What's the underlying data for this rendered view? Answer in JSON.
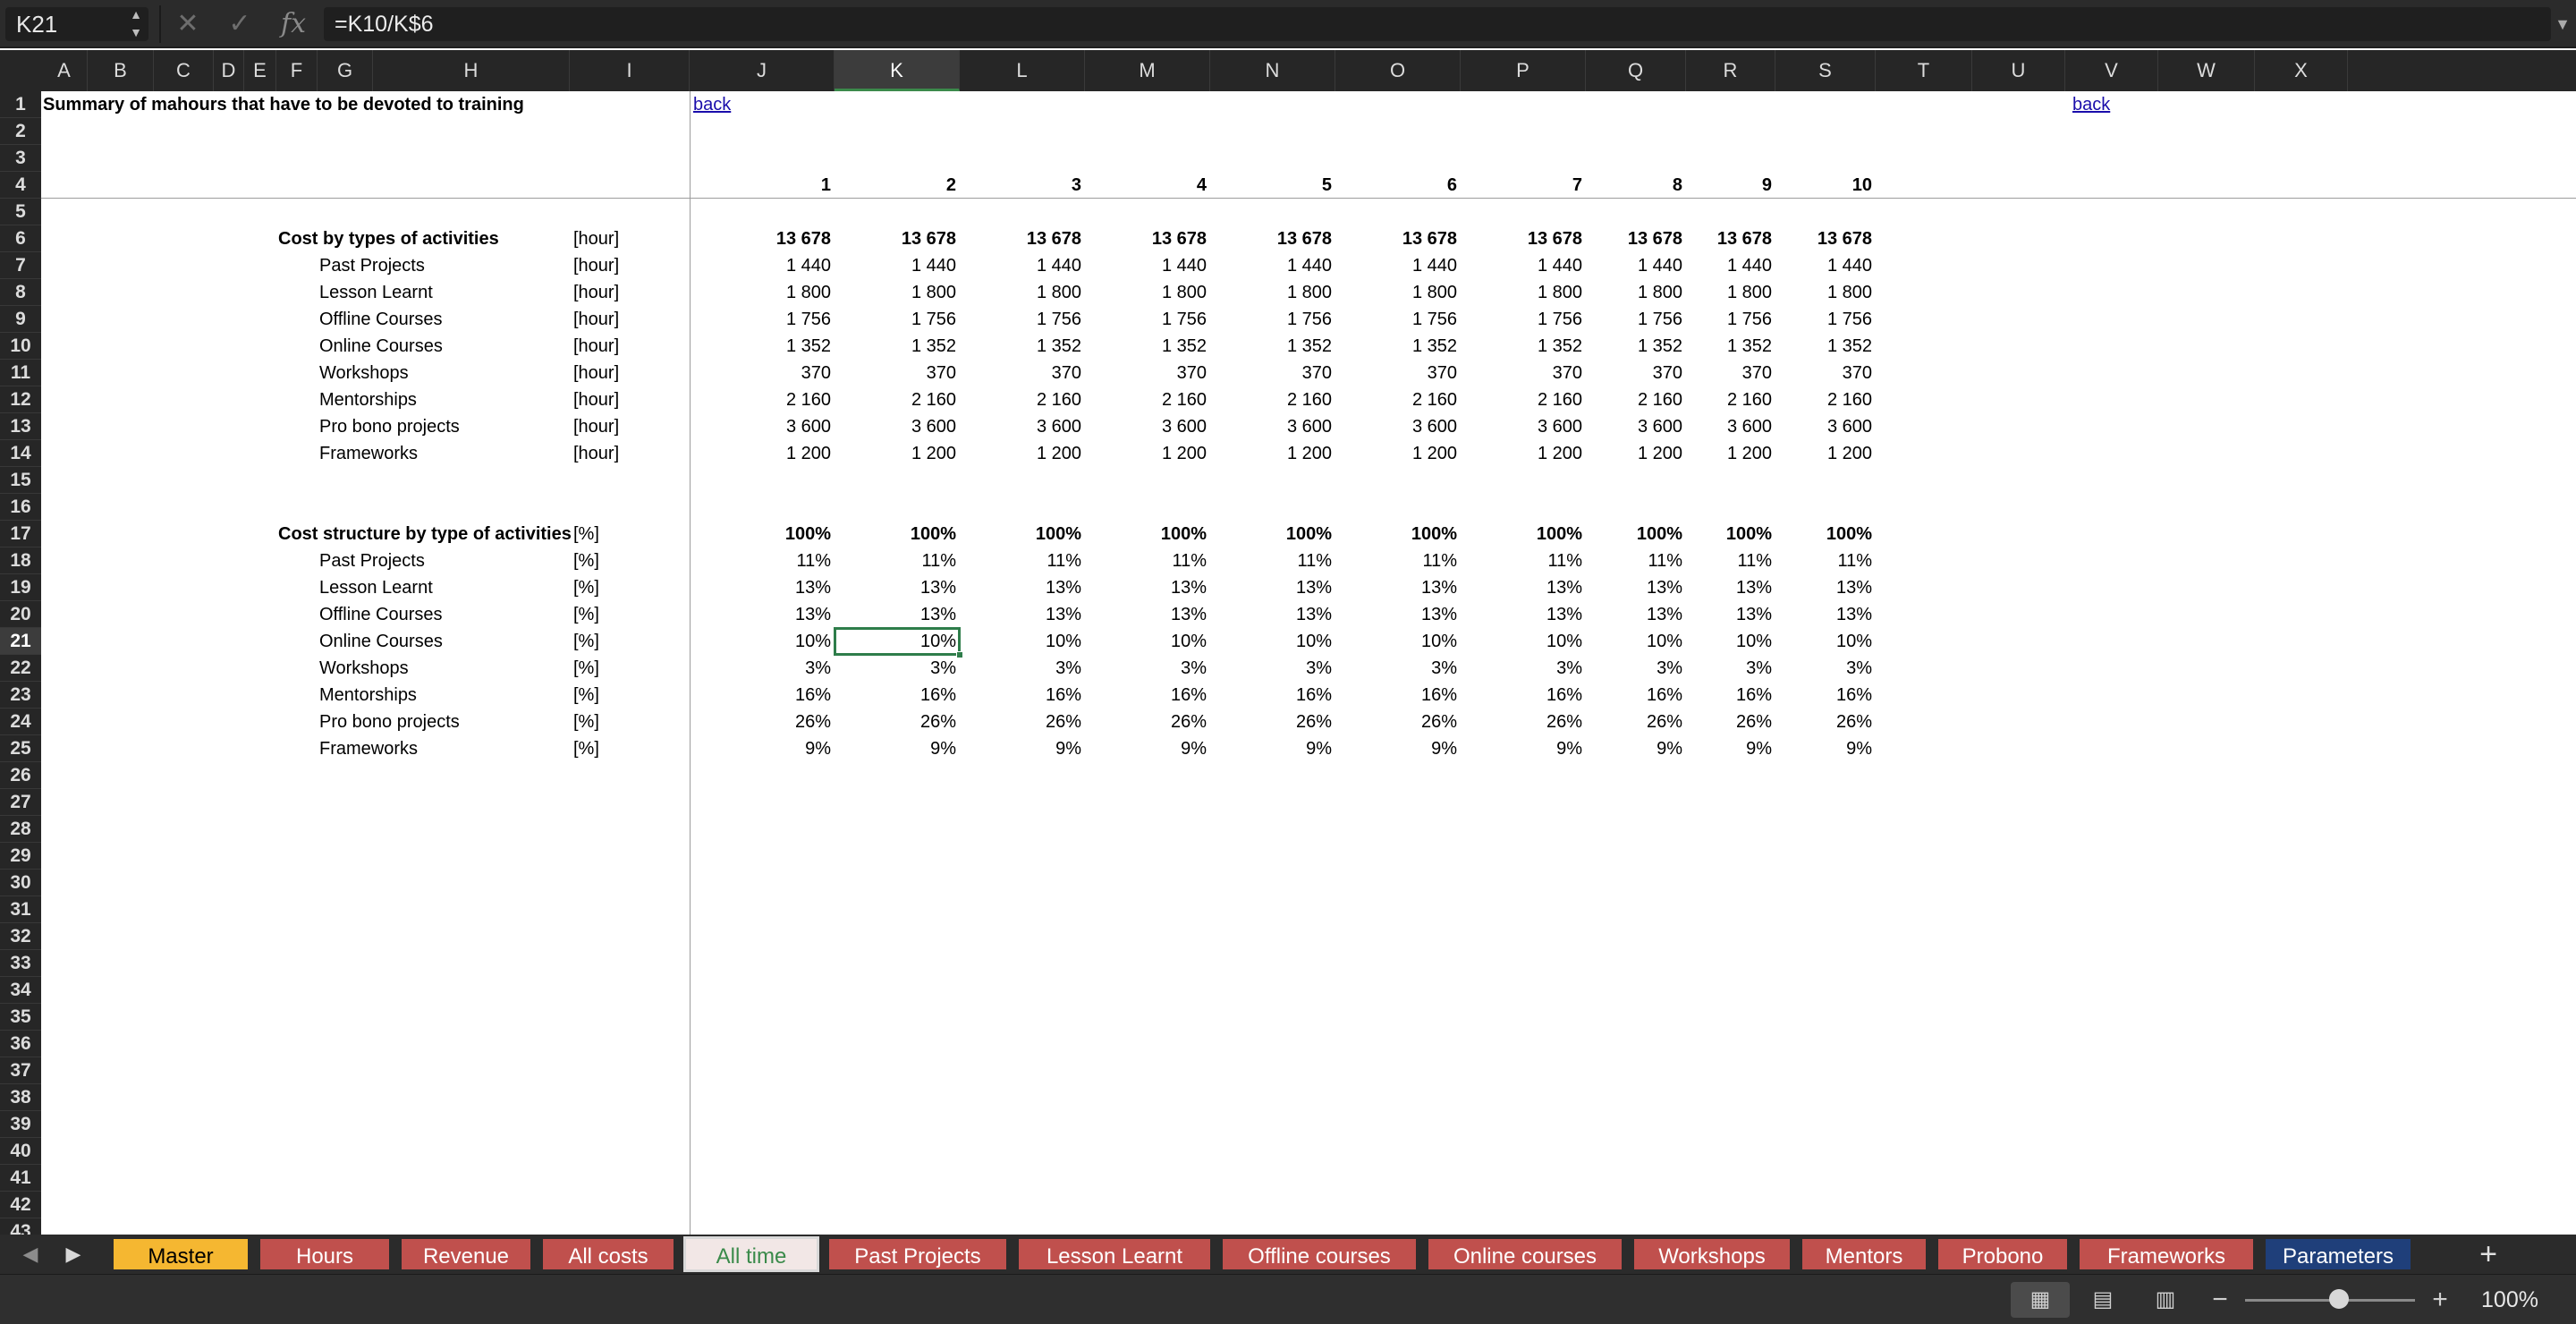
{
  "formula_bar": {
    "name_box": "K21",
    "formula": "=K10/K$6",
    "fx_label": "fx"
  },
  "columns": [
    "A",
    "B",
    "C",
    "D",
    "E",
    "F",
    "G",
    "H",
    "I",
    "J",
    "K",
    "L",
    "M",
    "N",
    "O",
    "P",
    "Q",
    "R",
    "S",
    "T",
    "U",
    "V",
    "W",
    "X"
  ],
  "active_column": "K",
  "rows_visible": [
    1,
    2,
    3,
    4,
    5,
    6,
    7,
    8,
    9,
    10,
    11,
    12,
    13,
    14,
    15,
    16,
    17,
    18,
    19,
    20,
    21,
    22,
    23,
    24,
    25,
    26,
    27,
    28,
    29,
    30,
    31,
    32,
    33,
    34,
    35,
    36,
    37,
    38,
    39,
    40,
    41,
    42,
    43
  ],
  "active_row": 21,
  "sheet": {
    "title": "Summary of mahours that have to be devoted to training",
    "back_link_label": "back",
    "period_headers": [
      "1",
      "2",
      "3",
      "4",
      "5",
      "6",
      "7",
      "8",
      "9",
      "10"
    ],
    "section_hours": {
      "label": "Cost by types of activities",
      "unit": "[hour]",
      "total": [
        "13 678",
        "13 678",
        "13 678",
        "13 678",
        "13 678",
        "13 678",
        "13 678",
        "13 678",
        "13 678",
        "13 678"
      ],
      "items": [
        {
          "label": "Past Projects",
          "unit": "[hour]",
          "values": [
            "1 440",
            "1 440",
            "1 440",
            "1 440",
            "1 440",
            "1 440",
            "1 440",
            "1 440",
            "1 440",
            "1 440"
          ]
        },
        {
          "label": "Lesson Learnt",
          "unit": "[hour]",
          "values": [
            "1 800",
            "1 800",
            "1 800",
            "1 800",
            "1 800",
            "1 800",
            "1 800",
            "1 800",
            "1 800",
            "1 800"
          ]
        },
        {
          "label": "Offline Courses",
          "unit": "[hour]",
          "values": [
            "1 756",
            "1 756",
            "1 756",
            "1 756",
            "1 756",
            "1 756",
            "1 756",
            "1 756",
            "1 756",
            "1 756"
          ]
        },
        {
          "label": "Online Courses",
          "unit": "[hour]",
          "values": [
            "1 352",
            "1 352",
            "1 352",
            "1 352",
            "1 352",
            "1 352",
            "1 352",
            "1 352",
            "1 352",
            "1 352"
          ]
        },
        {
          "label": "Workshops",
          "unit": "[hour]",
          "values": [
            "370",
            "370",
            "370",
            "370",
            "370",
            "370",
            "370",
            "370",
            "370",
            "370"
          ]
        },
        {
          "label": "Mentorships",
          "unit": "[hour]",
          "values": [
            "2 160",
            "2 160",
            "2 160",
            "2 160",
            "2 160",
            "2 160",
            "2 160",
            "2 160",
            "2 160",
            "2 160"
          ]
        },
        {
          "label": "Pro bono projects",
          "unit": "[hour]",
          "values": [
            "3 600",
            "3 600",
            "3 600",
            "3 600",
            "3 600",
            "3 600",
            "3 600",
            "3 600",
            "3 600",
            "3 600"
          ]
        },
        {
          "label": "Frameworks",
          "unit": "[hour]",
          "values": [
            "1 200",
            "1 200",
            "1 200",
            "1 200",
            "1 200",
            "1 200",
            "1 200",
            "1 200",
            "1 200",
            "1 200"
          ]
        }
      ]
    },
    "section_percent": {
      "label": "Cost structure by type of activities",
      "unit": "[%]",
      "total": [
        "100%",
        "100%",
        "100%",
        "100%",
        "100%",
        "100%",
        "100%",
        "100%",
        "100%",
        "100%"
      ],
      "items": [
        {
          "label": "Past Projects",
          "unit": "[%]",
          "values": [
            "11%",
            "11%",
            "11%",
            "11%",
            "11%",
            "11%",
            "11%",
            "11%",
            "11%",
            "11%"
          ]
        },
        {
          "label": "Lesson Learnt",
          "unit": "[%]",
          "values": [
            "13%",
            "13%",
            "13%",
            "13%",
            "13%",
            "13%",
            "13%",
            "13%",
            "13%",
            "13%"
          ]
        },
        {
          "label": "Offline Courses",
          "unit": "[%]",
          "values": [
            "13%",
            "13%",
            "13%",
            "13%",
            "13%",
            "13%",
            "13%",
            "13%",
            "13%",
            "13%"
          ]
        },
        {
          "label": "Online Courses",
          "unit": "[%]",
          "values": [
            "10%",
            "10%",
            "10%",
            "10%",
            "10%",
            "10%",
            "10%",
            "10%",
            "10%",
            "10%"
          ]
        },
        {
          "label": "Workshops",
          "unit": "[%]",
          "values": [
            "3%",
            "3%",
            "3%",
            "3%",
            "3%",
            "3%",
            "3%",
            "3%",
            "3%",
            "3%"
          ]
        },
        {
          "label": "Mentorships",
          "unit": "[%]",
          "values": [
            "16%",
            "16%",
            "16%",
            "16%",
            "16%",
            "16%",
            "16%",
            "16%",
            "16%",
            "16%"
          ]
        },
        {
          "label": "Pro bono projects",
          "unit": "[%]",
          "values": [
            "26%",
            "26%",
            "26%",
            "26%",
            "26%",
            "26%",
            "26%",
            "26%",
            "26%",
            "26%"
          ]
        },
        {
          "label": "Frameworks",
          "unit": "[%]",
          "values": [
            "9%",
            "9%",
            "9%",
            "9%",
            "9%",
            "9%",
            "9%",
            "9%",
            "9%",
            "9%"
          ]
        }
      ]
    }
  },
  "tabs": [
    {
      "label": "Master",
      "color": "#f5b731",
      "text_color": "#000000"
    },
    {
      "label": "Hours",
      "color": "#c0504d",
      "text_color": "#ffffff"
    },
    {
      "label": "Revenue",
      "color": "#c0504d",
      "text_color": "#ffffff"
    },
    {
      "label": "All costs",
      "color": "#c0504d",
      "text_color": "#ffffff"
    },
    {
      "label": "All time",
      "color": "#f2e7e6",
      "text_color": "#3a8a4a",
      "active": true
    },
    {
      "label": "Past Projects",
      "color": "#c0504d",
      "text_color": "#ffffff"
    },
    {
      "label": "Lesson Learnt",
      "color": "#c0504d",
      "text_color": "#ffffff"
    },
    {
      "label": "Offline courses",
      "color": "#c0504d",
      "text_color": "#ffffff"
    },
    {
      "label": "Online courses",
      "color": "#c0504d",
      "text_color": "#ffffff"
    },
    {
      "label": "Workshops",
      "color": "#c0504d",
      "text_color": "#ffffff"
    },
    {
      "label": "Mentors",
      "color": "#c0504d",
      "text_color": "#ffffff"
    },
    {
      "label": "Probono",
      "color": "#c0504d",
      "text_color": "#ffffff"
    },
    {
      "label": "Frameworks",
      "color": "#c0504d",
      "text_color": "#ffffff"
    },
    {
      "label": "Parameters",
      "color": "#1f3f7a",
      "text_color": "#ffffff"
    }
  ],
  "status_bar": {
    "zoom_level": "100%",
    "zoom_fraction": 0.55
  },
  "icons": {
    "cancel": "close-icon",
    "confirm": "check-icon",
    "fx": "function-icon",
    "add_sheet": "plus-icon"
  },
  "colors": {
    "selection": "#2e7d4a",
    "link": "#1a0dab",
    "chrome": "#2b2b2b"
  }
}
